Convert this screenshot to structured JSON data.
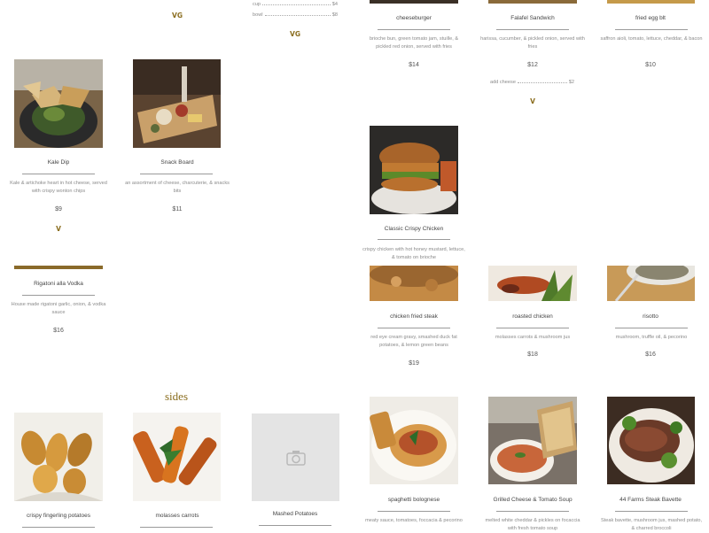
{
  "badges": {
    "vg": "VG",
    "v": "V"
  },
  "soup_options": [
    {
      "label": "cup",
      "price": "$4"
    },
    {
      "label": "bowl",
      "price": "$8"
    }
  ],
  "addon": {
    "label": "add cheese",
    "price": "$2"
  },
  "items": {
    "cheeseburger": {
      "name": "cheeseburger",
      "desc": "brioche bun, green tomato jam, stuille, & pickled red onion, served with fries",
      "price": "$14"
    },
    "falafel": {
      "name": "Falafel Sandwich",
      "desc": "harissa, cucumber, & pickled onion, served with fries",
      "price": "$12"
    },
    "egg_blt": {
      "name": "fried egg blt",
      "desc": "saffron aioli, tomato, lettuce, cheddar, & bacon",
      "price": "$10"
    },
    "kale_dip": {
      "name": "Kale Dip",
      "desc": "Kale & artichoke heart in hot cheese, served with crispy wonton chips",
      "price": "$9"
    },
    "snack_board": {
      "name": "Snack Board",
      "desc": "an assortment of cheese, charcuterie, & snacks bits",
      "price": "$11"
    },
    "crispy_chicken": {
      "name": "Classic Crispy Chicken",
      "desc": "crispy chicken with hot honey mustard, lettuce, & tomato on brioche"
    },
    "rigatoni": {
      "name": "Rigatoni alla Vodka",
      "desc": "House made rigatoni garlic, onion, & vodka sauce",
      "price": "$16"
    },
    "chicken_fried_steak": {
      "name": "chicken fried steak",
      "desc": "red eye cream gravy, smashed duck fat potatoes, & lemon green beans",
      "price": "$19"
    },
    "roasted_chicken": {
      "name": "roasted chicken",
      "desc": "molasses carrots & mushroom jus",
      "price": "$18"
    },
    "risotto": {
      "name": "risotto",
      "desc": "mushroom, truffle oil, & pecorino",
      "price": "$16"
    },
    "fingerling": {
      "name": "crispy fingerling potatoes"
    },
    "molasses_carrots": {
      "name": "molasses carrots"
    },
    "mashed_potatoes": {
      "name": "Mashed Potatoes"
    },
    "spaghetti": {
      "name": "spaghetti bolognese",
      "desc": "meaty sauce, tomatoes, foccacia & pecorino"
    },
    "grilled_cheese": {
      "name": "Grilled Cheese & Tomato Soup",
      "desc": "melted white cheddar & pickles on focaccia with fresh tomato soup"
    },
    "steak": {
      "name": "44 Farms Steak Bavette",
      "desc": "Steak bavette, mushroom jus, mashed potato, & charred broccoli"
    }
  },
  "sections": {
    "sides": "sides"
  }
}
